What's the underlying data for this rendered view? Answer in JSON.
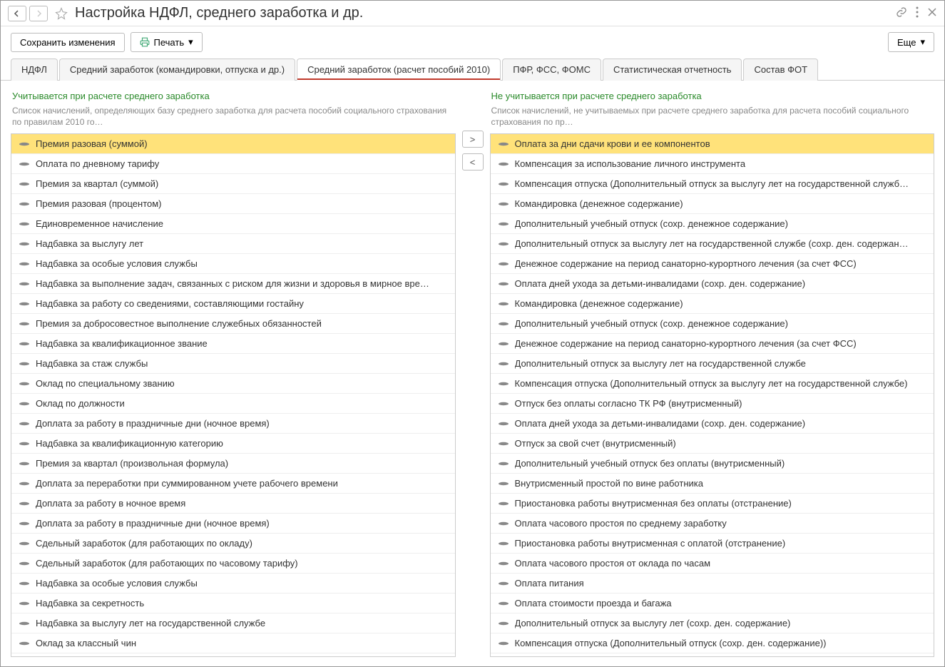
{
  "header": {
    "title": "Настройка НДФЛ, среднего заработка и др."
  },
  "toolbar": {
    "save_label": "Сохранить изменения",
    "print_label": "Печать",
    "more_label": "Еще"
  },
  "tabs": [
    {
      "label": "НДФЛ"
    },
    {
      "label": "Средний заработок (командировки, отпуска и др.)"
    },
    {
      "label": "Средний заработок (расчет пособий 2010)"
    },
    {
      "label": "ПФР, ФСС, ФОМС"
    },
    {
      "label": "Статистическая отчетность"
    },
    {
      "label": "Состав ФОТ"
    }
  ],
  "left_column": {
    "title": "Учитывается при расчете среднего заработка",
    "desc": "Список начислений, определяющих базу среднего заработка для расчета пособий социального страхования по правилам 2010 го…",
    "items": [
      "Премия разовая (суммой)",
      "Оплата по дневному тарифу",
      "Премия за квартал (суммой)",
      "Премия разовая (процентом)",
      "Единовременное начисление",
      "Надбавка за выслугу лет",
      "Надбавка за особые условия службы",
      "Надбавка за выполнение задач, связанных с риском для жизни и здоровья в мирное вре…",
      "Надбавка за работу со сведениями, составляющими гостайну",
      "Премия за добросовестное выполнение служебных обязанностей",
      "Надбавка за квалификационное звание",
      "Надбавка за стаж службы",
      "Оклад по специальному званию",
      "Оклад по должности",
      "Доплата за работу в праздничные дни (ночное время)",
      "Надбавка за квалификационную категорию",
      "Премия за квартал (произвольная формула)",
      "Доплата за переработки при суммированном учете рабочего времени",
      "Доплата за работу в ночное время",
      "Доплата за работу в праздничные дни (ночное время)",
      "Сдельный заработок (для работающих по окладу)",
      "Сдельный заработок (для работающих по часовому тарифу)",
      "Надбавка за особые условия службы",
      "Надбавка за секретность",
      "Надбавка за выслугу лет на государственной службе",
      "Оклад за классный чин"
    ]
  },
  "right_column": {
    "title": "Не учитывается при расчете среднего заработка",
    "desc": "Список начислений, не учитываемых при расчете среднего заработка для расчета пособий социального страхования по пр…",
    "items": [
      "Оплата за дни сдачи крови и ее компонентов",
      "Компенсация за использование личного инструмента",
      "Компенсация отпуска (Дополнительный отпуск за выслугу лет на государственной служб…",
      "Командировка (денежное содержание)",
      "Дополнительный учебный отпуск (сохр. денежное содержание)",
      "Дополнительный отпуск за выслугу лет на государственной службе (сохр. ден. содержан…",
      "Денежное содержание на период санаторно-курортного лечения (за счет ФСС)",
      "Оплата дней ухода за детьми-инвалидами (сохр. ден. содержание)",
      "Командировка (денежное содержание)",
      "Дополнительный учебный отпуск (сохр. денежное содержание)",
      "Денежное содержание на период санаторно-курортного лечения (за счет ФСС)",
      "Дополнительный отпуск за выслугу лет на государственной службе",
      "Компенсация отпуска (Дополнительный отпуск за выслугу лет на государственной службе)",
      "Отпуск без оплаты согласно ТК РФ (внутрисменный)",
      "Оплата дней ухода за детьми-инвалидами (сохр. ден. содержание)",
      "Отпуск за свой счет (внутрисменный)",
      "Дополнительный учебный отпуск без оплаты (внутрисменный)",
      "Внутрисменный простой по вине работника",
      "Приостановка работы внутрисменная без оплаты (отстранение)",
      "Оплата часового простоя по среднему заработку",
      "Приостановка работы внутрисменная с оплатой (отстранение)",
      "Оплата часового простоя от оклада по часам",
      "Оплата питания",
      "Оплата стоимости проезда и багажа",
      "Дополнительный отпуск за выслугу лет (сохр. ден. содержание)",
      "Компенсация отпуска (Дополнительный отпуск (сохр. ден. содержание))"
    ]
  },
  "move_buttons": {
    "right": ">",
    "left": "<"
  }
}
